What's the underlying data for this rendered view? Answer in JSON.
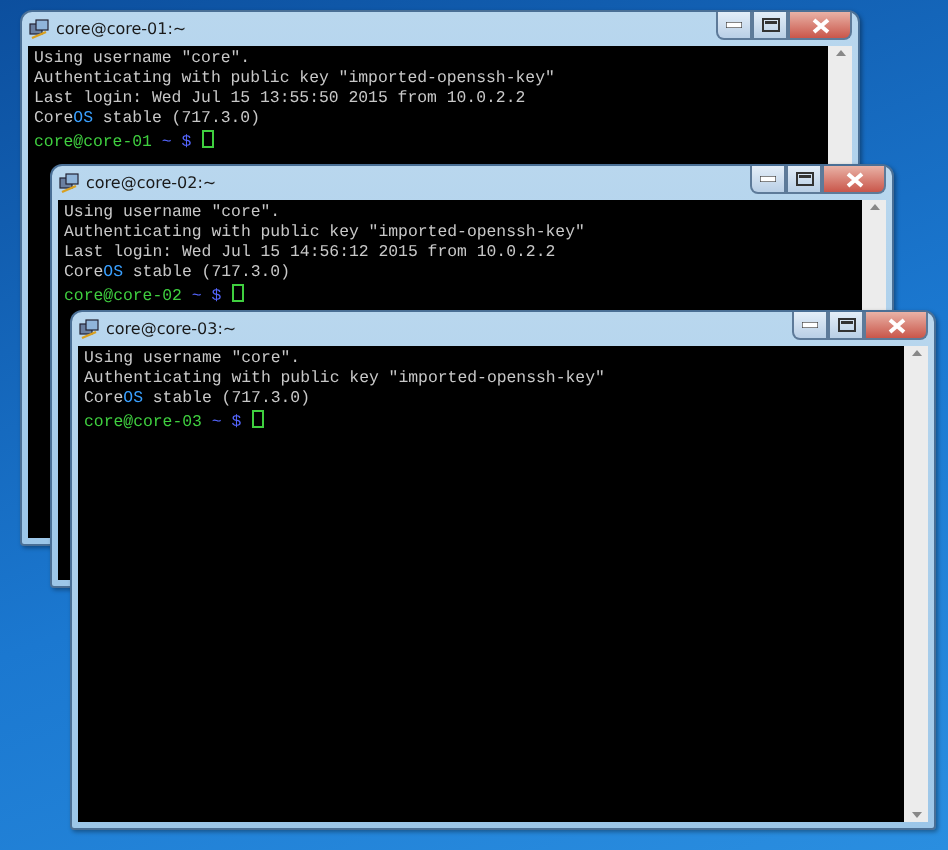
{
  "windows": [
    {
      "title": "core@core-01:~",
      "cursor": true,
      "lines": [
        [
          {
            "text": "Using username \"core\".",
            "color": "#c8c8c8"
          }
        ],
        [
          {
            "text": "Authenticating with public key \"imported-openssh-key\"",
            "color": "#c8c8c8"
          }
        ],
        [
          {
            "text": "Last login: Wed Jul 15 13:55:50 2015 from 10.0.2.2",
            "color": "#c8c8c8"
          }
        ],
        [
          {
            "text": "Core",
            "color": "#c8c8c8"
          },
          {
            "text": "OS",
            "color": "#3aa0ff"
          },
          {
            "text": " stable (717.3.0)",
            "color": "#c8c8c8"
          }
        ],
        [
          {
            "text": "core@core-01",
            "color": "#3fcf3f"
          },
          {
            "text": " ~ $ ",
            "color": "#5566ff"
          }
        ]
      ]
    },
    {
      "title": "core@core-02:~",
      "cursor": true,
      "lines": [
        [
          {
            "text": "Using username \"core\".",
            "color": "#c8c8c8"
          }
        ],
        [
          {
            "text": "Authenticating with public key \"imported-openssh-key\"",
            "color": "#c8c8c8"
          }
        ],
        [
          {
            "text": "Last login: Wed Jul 15 14:56:12 2015 from 10.0.2.2",
            "color": "#c8c8c8"
          }
        ],
        [
          {
            "text": "Core",
            "color": "#c8c8c8"
          },
          {
            "text": "OS",
            "color": "#3aa0ff"
          },
          {
            "text": " stable (717.3.0)",
            "color": "#c8c8c8"
          }
        ],
        [
          {
            "text": "core@core-02",
            "color": "#3fcf3f"
          },
          {
            "text": " ~ $ ",
            "color": "#5566ff"
          }
        ]
      ]
    },
    {
      "title": "core@core-03:~",
      "cursor": true,
      "lines": [
        [
          {
            "text": "Using username \"core\".",
            "color": "#c8c8c8"
          }
        ],
        [
          {
            "text": "Authenticating with public key \"imported-openssh-key\"",
            "color": "#c8c8c8"
          }
        ],
        [
          {
            "text": "Core",
            "color": "#c8c8c8"
          },
          {
            "text": "OS",
            "color": "#3aa0ff"
          },
          {
            "text": " stable (717.3.0)",
            "color": "#c8c8c8"
          }
        ],
        [
          {
            "text": "core@core-03",
            "color": "#3fcf3f"
          },
          {
            "text": " ~ $ ",
            "color": "#5566ff"
          }
        ]
      ]
    }
  ]
}
